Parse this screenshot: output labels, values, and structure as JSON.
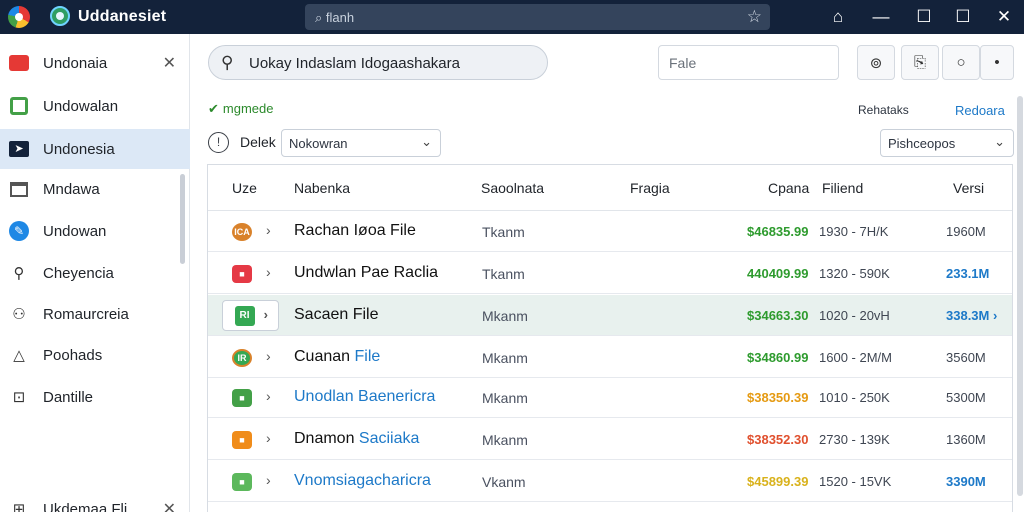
{
  "titlebar": {
    "title": "Uddanesiet",
    "search_text": "⌕ flanh",
    "icons": [
      "home-icon",
      "minimize-icon",
      "restore-icon",
      "maximize-icon",
      "close-icon"
    ]
  },
  "sidebar": {
    "items": [
      {
        "label": "Undonaia",
        "icon": "tag-icon",
        "color": "#e53935"
      },
      {
        "label": "Undowalan",
        "icon": "green-square-icon",
        "color": "#43a047"
      },
      {
        "label": "Undonesia",
        "icon": "send-icon",
        "color": "#13223a"
      },
      {
        "label": "Mndawa",
        "icon": "window-icon",
        "color": "#555555"
      },
      {
        "label": "Undowan",
        "icon": "wrench-icon",
        "color": "#1e88e5"
      },
      {
        "label": "Cheyencia",
        "icon": "user-icon",
        "color": "#333333"
      },
      {
        "label": "Romaurcreia",
        "icon": "users-icon",
        "color": "#333333"
      },
      {
        "label": "Poohads",
        "icon": "warning-icon",
        "color": "#333333"
      },
      {
        "label": "Dantille",
        "icon": "box-icon",
        "color": "#333333"
      }
    ],
    "footer_label": "Ukdemaa Fli"
  },
  "toolbar": {
    "search_value": "Uokay Indaslam Idogaashakara",
    "filter_placeholder": "Fale"
  },
  "status": {
    "text": "mgmede",
    "link_a": "Rehataks",
    "link_b": "Redoara"
  },
  "filters": {
    "select_label": "Delek",
    "select_value": "Nokowran",
    "select2_value": "Pishceopos"
  },
  "table": {
    "headers": [
      "Uze",
      "Nabenka",
      "Saoolnata",
      "Fragia",
      "Cpana",
      "Filiend",
      "Versi"
    ],
    "rows": [
      {
        "name": "Rachan Iøoa File",
        "col2": "Tkanm",
        "price": "$46835.99",
        "price_color": "#2e9b2e",
        "range": "1930 - 7H/K",
        "size": "1960M",
        "icon_color": "#d9822b",
        "icon_text": "ICA"
      },
      {
        "name": "Undwlan Pae Raclia",
        "col2": "Tkanm",
        "price": "440409.99",
        "price_color": "#2e9b2e",
        "range": "1320 - 590K",
        "size": "233.1M",
        "size_blue": true,
        "icon_color": "#e53945",
        "icon_text": "■"
      },
      {
        "name": "Sacaen File",
        "col2": "Mkanm",
        "price": "$34663.30",
        "price_color": "#2e9b2e",
        "range": "1020 - 20vH",
        "size": "338.3M ›",
        "size_blue": true,
        "icon_color": "#34a853",
        "icon_text": "RI",
        "selected": true
      },
      {
        "name_a": "Cuanan ",
        "name_b": "File",
        "col2": "Mkanm",
        "price": "$34860.99",
        "price_color": "#2e9b2e",
        "range": "1600 - 2M/M",
        "size": "3560M",
        "icon_color": "#34a853",
        "icon_text": "IR"
      },
      {
        "name": "Unodlan Baenericra",
        "link": true,
        "col2": "Mkanm",
        "price": "$38350.39",
        "price_color": "#e59a12",
        "range": "1010 - 250K",
        "size": "5300M",
        "icon_color": "#43a047",
        "icon_text": "■"
      },
      {
        "name_a": "Dnamon ",
        "name_b": "Saciiaka",
        "col2": "Mkanm",
        "price": "$38352.30",
        "price_color": "#e0502e",
        "range": "2730 - 139K",
        "size": "1360M",
        "icon_color": "#f08c1a",
        "icon_text": "■"
      },
      {
        "name": "Vnomsiagacharicra",
        "link": true,
        "col2": "Vkanm",
        "price": "$45899.39",
        "price_color": "#d9b21c",
        "range": "1520 - 15VK",
        "size": "3390M",
        "size_blue": true,
        "icon_color": "#5cb85c",
        "icon_text": "■"
      }
    ]
  }
}
